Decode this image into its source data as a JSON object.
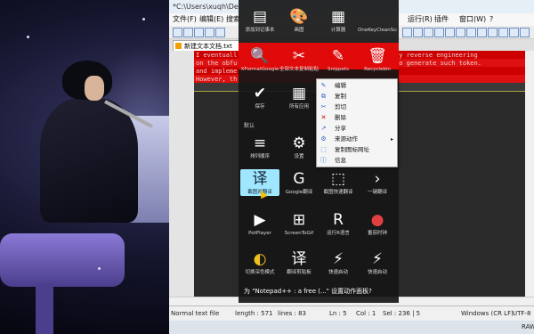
{
  "window": {
    "title": "*C:\\Users\\xuqh\\De",
    "menu": [
      "文件(F)",
      "编辑(E)",
      "搜索",
      "运行(R)",
      "插件",
      "窗口(W)",
      "?"
    ],
    "tab_label": "新建文本文档.txt"
  },
  "editor": {
    "lines": [
      "I eventuall",
      "on the obfu",
      "and impleme",
      "However, th"
    ],
    "right_lines": [
      "by reverse engineering",
      "to generate such token."
    ]
  },
  "statusbar": {
    "type": "Normal text file",
    "length": "length : 571",
    "lines": "lines : 83",
    "ln": "Ln : 5",
    "col": "Col : 1",
    "sel": "Sel : 236 | 5",
    "eol": "Windows (CR LF)",
    "encoding": "UTF-8",
    "mode": "INS"
  },
  "taskbar": {
    "ime": "RAW"
  },
  "panel": {
    "row1": [
      {
        "icon": "▤",
        "label": "添加到记事本"
      },
      {
        "icon": "🎨",
        "label": "画图"
      },
      {
        "icon": "▦",
        "label": "计算器"
      },
      {
        "icon": "",
        "label": "OneKeyCleanScreen"
      }
    ],
    "row2": [
      {
        "icon": "🔍",
        "label": "XFormatGoogle"
      },
      {
        "icon": "✂",
        "label": "全部文本复制粘贴"
      },
      {
        "icon": "✎",
        "label": "Snippets"
      },
      {
        "icon": "🗑",
        "label": "Recyclebin"
      }
    ],
    "row3": [
      {
        "icon": "✔",
        "label": "保存"
      },
      {
        "icon": "▦",
        "label": "所有应用"
      }
    ],
    "section_label": "默认",
    "row4": [
      {
        "icon": "≡",
        "label": "排列顺序"
      },
      {
        "icon": "⚙",
        "label": "设置"
      }
    ],
    "row5": [
      {
        "icon": "译",
        "label": "截图并翻译"
      },
      {
        "icon": "G",
        "label": "Google翻译"
      },
      {
        "icon": "⬚",
        "label": "截图快速翻译"
      },
      {
        "icon": "›",
        "label": "一键翻译"
      }
    ],
    "row6": [
      {
        "icon": "▶",
        "label": "PotPlayer"
      },
      {
        "icon": "⊞",
        "label": "ScreenToGif"
      },
      {
        "icon": "R",
        "label": "运行R语言"
      },
      {
        "icon": "●",
        "label": "番茄时钟"
      }
    ],
    "row7": [
      {
        "icon": "◐",
        "label": "切换深色模式"
      },
      {
        "icon": "译",
        "label": "翻译剪贴板"
      },
      {
        "icon": "⚡",
        "label": "快速启动"
      },
      {
        "icon": "⚡",
        "label": "快速启动"
      }
    ],
    "prompt": "为 \"Notepad++ : a free (...\" 设置动作面板?"
  },
  "context_menu": {
    "items": [
      {
        "icon": "✎",
        "label": "编辑"
      },
      {
        "icon": "⧉",
        "label": "复制"
      },
      {
        "icon": "✂",
        "label": "剪切"
      },
      {
        "icon": "✕",
        "label": "删除"
      },
      {
        "icon": "↗",
        "label": "分享"
      },
      {
        "icon": "⚙",
        "label": "来源动作"
      },
      {
        "icon": "⬚",
        "label": "复制图标网址"
      },
      {
        "icon": "ⓘ",
        "label": "信息"
      }
    ]
  }
}
